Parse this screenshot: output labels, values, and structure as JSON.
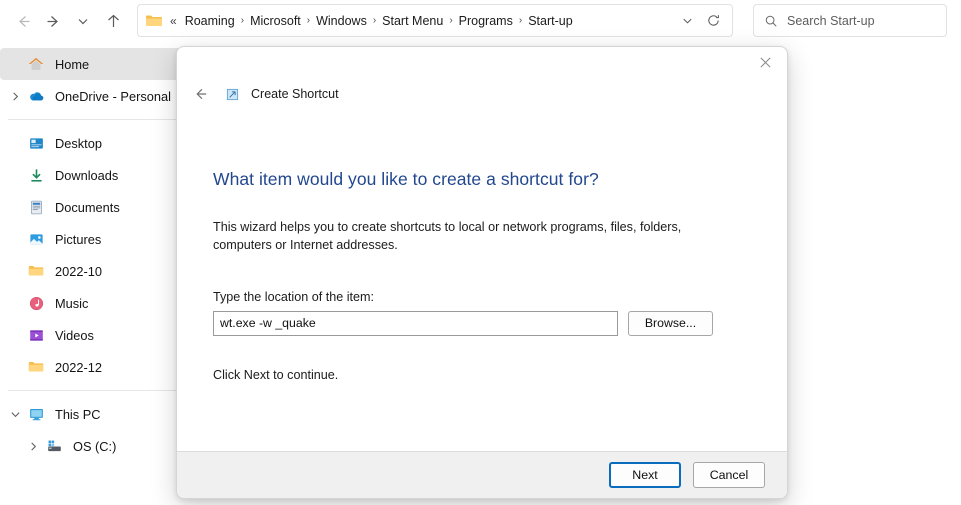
{
  "window": {
    "nav": [
      {
        "name": "back",
        "icon": "arrow-left-icon",
        "disabled": true
      },
      {
        "name": "forward",
        "icon": "arrow-right-icon",
        "disabled": false
      },
      {
        "name": "recent-locations",
        "icon": "chevron-down-icon",
        "disabled": false
      },
      {
        "name": "up",
        "icon": "arrow-up-icon",
        "disabled": false
      }
    ]
  },
  "address": {
    "folder_icon": "folder-icon",
    "overflow": "«",
    "crumbs": [
      "Roaming",
      "Microsoft",
      "Windows",
      "Start Menu",
      "Programs",
      "Start-up"
    ],
    "separator": "›",
    "dropdown_icon": "chevron-down-icon",
    "refresh_icon": "refresh-icon"
  },
  "search": {
    "icon": "search-icon",
    "placeholder": "Search Start-up",
    "value": ""
  },
  "sidebar": {
    "groups": [
      {
        "items": [
          {
            "label": "Home",
            "icon": "home-icon",
            "expandable": false,
            "expanded": false,
            "selected": true,
            "indent": false
          },
          {
            "label": "OneDrive - Personal",
            "icon": "onedrive-icon",
            "expandable": true,
            "expanded": false,
            "selected": false,
            "indent": false
          }
        ]
      },
      {
        "items": [
          {
            "label": "Desktop",
            "icon": "desktop-icon",
            "expandable": false,
            "expanded": false,
            "selected": false,
            "indent": false
          },
          {
            "label": "Downloads",
            "icon": "downloads-icon",
            "expandable": false,
            "expanded": false,
            "selected": false,
            "indent": false
          },
          {
            "label": "Documents",
            "icon": "documents-icon",
            "expandable": false,
            "expanded": false,
            "selected": false,
            "indent": false
          },
          {
            "label": "Pictures",
            "icon": "pictures-icon",
            "expandable": false,
            "expanded": false,
            "selected": false,
            "indent": false
          },
          {
            "label": "2022-10",
            "icon": "folder-icon",
            "expandable": false,
            "expanded": false,
            "selected": false,
            "indent": false
          },
          {
            "label": "Music",
            "icon": "music-icon",
            "expandable": false,
            "expanded": false,
            "selected": false,
            "indent": false
          },
          {
            "label": "Videos",
            "icon": "videos-icon",
            "expandable": false,
            "expanded": false,
            "selected": false,
            "indent": false
          },
          {
            "label": "2022-12",
            "icon": "folder-icon",
            "expandable": false,
            "expanded": false,
            "selected": false,
            "indent": false
          }
        ]
      },
      {
        "items": [
          {
            "label": "This PC",
            "icon": "this-pc-icon",
            "expandable": true,
            "expanded": true,
            "selected": false,
            "indent": false
          },
          {
            "label": "OS (C:)",
            "icon": "drive-icon",
            "expandable": true,
            "expanded": false,
            "selected": false,
            "indent": true
          }
        ]
      }
    ]
  },
  "dialog": {
    "close_icon": "close-icon",
    "back_icon": "arrow-left-icon",
    "title_icon": "shortcut-icon",
    "title": "Create Shortcut",
    "heading": "What item would you like to create a shortcut for?",
    "paragraph": "This wizard helps you to create shortcuts to local or network programs, files, folders, computers or Internet addresses.",
    "field_label": "Type the location of the item:",
    "input_value": "wt.exe -w _quake",
    "input_placeholder": "",
    "browse_label": "Browse...",
    "note": "Click Next to continue.",
    "next_label": "Next",
    "cancel_label": "Cancel"
  },
  "colors": {
    "heading_blue": "#22478f",
    "focus_blue": "#0a6cbd",
    "selection_gray": "#e4e4e4",
    "footer_gray": "#f0f0f0"
  }
}
